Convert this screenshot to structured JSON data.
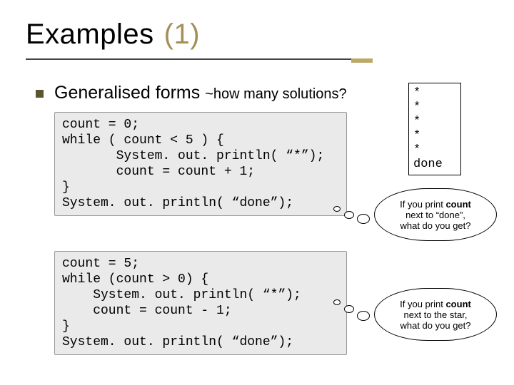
{
  "title": {
    "main": "Examples",
    "paren": "(1)"
  },
  "subhead": {
    "lead": "Generalised forms ",
    "tail": "~how many solutions?"
  },
  "code1": {
    "l0": "count = 0;",
    "l1": "while ( count < 5 ) {",
    "l2": "       System. out. println( “*”);",
    "l3": "       count = count + 1;",
    "l4": "}",
    "l5": "System. out. println( “done”);"
  },
  "code2": {
    "l0": "count = 5;",
    "l1": "while (count > 0) {",
    "l2": "    System. out. println( “*”);",
    "l3": "    count = count - 1;",
    "l4": "}",
    "l5": "System. out. println( “done”);"
  },
  "output": {
    "l0": "*",
    "l1": "*",
    "l2": "*",
    "l3": "*",
    "l4": "*",
    "l5": "done"
  },
  "thought1": {
    "pre": "If you print ",
    "bold": "count",
    "line2": "next to “done”,",
    "line3": "what do you get?"
  },
  "thought2": {
    "pre": "If you print ",
    "bold": "count",
    "line2": "next to the star,",
    "line3": "what do you get?"
  }
}
